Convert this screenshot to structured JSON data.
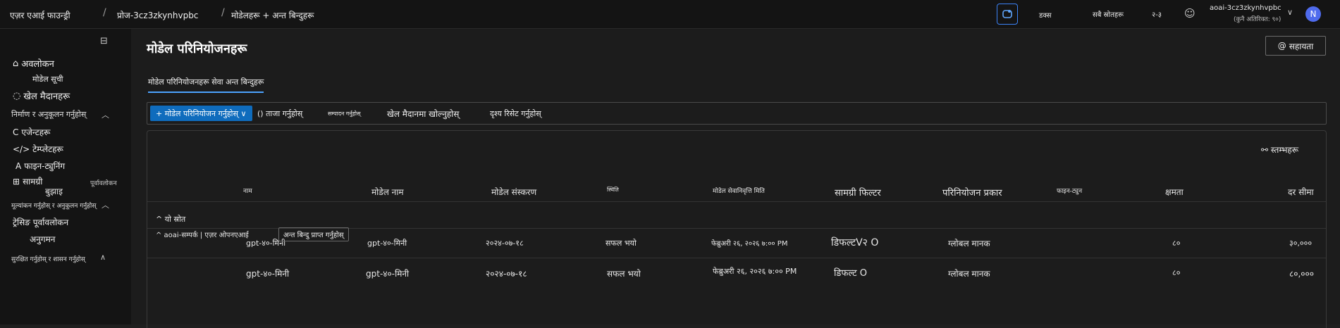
{
  "topbar": {
    "brand": "एज़र एआई फाउन्ड्री",
    "project": "प्रोज-3cz3zkynhvpbc",
    "page": "मोडेलहरू + अन्त बिन्दुहरू",
    "item1": "डक्स",
    "item2": "सबै स्रोतहरू",
    "item3": "२-३",
    "account_name": "aoai-3cz3zkynhvpbc",
    "account_sub": "(कुनै अतिरिक्त: ९०)",
    "avatar_letter": "N"
  },
  "sidebar": {
    "overview": "अवलोकन",
    "model_list": "मोडेल सूची",
    "playground": "खेल मैदानहरू",
    "build_section": "निर्माण र अनुकूलन गर्नुहोस्",
    "agents": "एजेन्टहरू",
    "templates": "टेम्प्लेटहरू",
    "finetune": "फाइन-ट्युनिंग",
    "content": "सामग्री",
    "understand": "बुझाइ",
    "preview": "पूर्वावलोकन",
    "assess_section": "मूल्यांकन गर्नुहोस् र अनुकूलन गर्नुहोस्",
    "trace_preview": "ट्रेसिङ पूर्वावलोकन",
    "monitoring": "अनुगमन",
    "secure_section": "सुरक्षित गर्नुहोस् र शासन गर्नुहोस्"
  },
  "main": {
    "title": "मोडेल परिनियोजनहरू",
    "help": "सहायता",
    "tab": "मोडेल परिनियोजनहरू सेवा अन्त बिन्दुहरू",
    "toolbar": {
      "deploy": "+ मोडेल परिनियोजन गर्नुहोस् ∨",
      "refresh": "ताजा गर्नुहोस्",
      "edit": "सम्पादन गर्नुहोस्",
      "open_playground": "खेल मैदानमा खोल्नुहोस्",
      "reset_view": "दृश्य रिसेट गर्नुहोस्"
    },
    "columns_btn": "स्तम्भहरू",
    "columns": [
      "नाम",
      "मोडेल नाम",
      "मोडेल संस्करण",
      "स्थिति",
      "मोडेल सेवानिवृत्ति मिति",
      "सामग्री फिल्टर",
      "परिनियोजन प्रकार",
      "फाइन-ट्युन",
      "क्षमता",
      "दर सीमा"
    ],
    "group1": "^ यो स्रोत",
    "group2": "^ aoai-सम्पर्क | एज़र ओपनएआई",
    "get_endpoint": "अन्त बिन्दु प्राप्त गर्नुहोस्",
    "rows": [
      {
        "name": "gpt-४०-मिनी",
        "model": "gpt-४०-मिनी",
        "version": "२०२४-०७-१८",
        "status": "सफल भयो",
        "retire": "फेब्रुअरी २६, २०२६ ७:०० PM",
        "filter": "डिफल्टV२ O",
        "type": "ग्लोबल मानक",
        "capacity": "८०",
        "rate": "३०,०००"
      },
      {
        "name": "gpt-४०-मिनी",
        "model": "gpt-४०-मिनी",
        "version": "२०२४-०७-१८",
        "status": "सफल भयो",
        "retire": "फेब्रुअरी २६, २०२६ ७:०० PM",
        "filter": "डिफल्ट O",
        "type": "ग्लोबल मानक",
        "capacity": "८०",
        "rate": "८०,०००"
      }
    ]
  },
  "colors": {
    "accent": "#0f6cbd",
    "avatar": "#4f6bed",
    "copilot": "#3b82f6"
  }
}
